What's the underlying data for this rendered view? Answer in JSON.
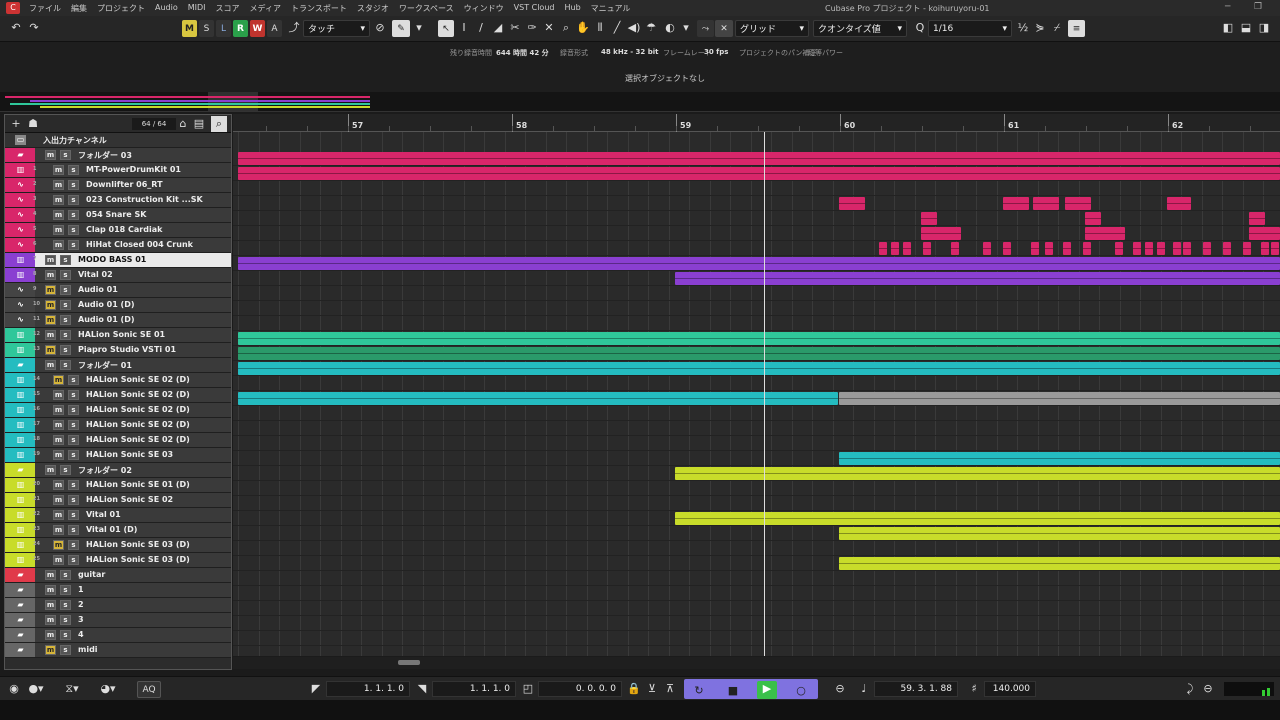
{
  "menu": {
    "items": [
      "ファイル",
      "編集",
      "プロジェクト",
      "Audio",
      "MIDI",
      "スコア",
      "メディア",
      "トランスポート",
      "スタジオ",
      "ワークスペース",
      "ウィンドウ",
      "VST Cloud",
      "Hub",
      "マニュアル"
    ],
    "window_title": "Cubase Pro プロジェクト - koihuruyoru-01"
  },
  "toolbar": {
    "m": "M",
    "s": "S",
    "l": "L",
    "r": "R",
    "w": "W",
    "a": "A",
    "automation_mode": "タッチ",
    "snap_type": "グリッド",
    "quantize_type": "クオンタイズ値",
    "quantize_value": "1/16"
  },
  "info": {
    "rec_time_label": "残り録音時間",
    "rec_time": "644 時間 42 分",
    "rec_format_label": "録音形式",
    "rec_format": "48 kHz - 32 bit",
    "framerate_label": "フレームレート",
    "framerate": "30 fps",
    "pan_label": "プロジェクトのパン補正",
    "pan": "均等パワー"
  },
  "selection": "選択オブジェクトなし",
  "trackpanel": {
    "count": "64 / 64",
    "io_label": "入出力チャンネル"
  },
  "ruler": [
    "57",
    "58",
    "59",
    "60",
    "61",
    "62"
  ],
  "tracks": [
    {
      "name": "フォルダー 03",
      "num": "",
      "type": "folder",
      "color": "#d8266a"
    },
    {
      "name": "MT-PowerDrumKit 01",
      "num": "1",
      "type": "inst",
      "color": "#d8266a"
    },
    {
      "name": "Downlifter 06_RT",
      "num": "2",
      "type": "audio",
      "color": "#d8266a"
    },
    {
      "name": "023 Construction Kit ...SK",
      "num": "3",
      "type": "audio",
      "color": "#d8266a"
    },
    {
      "name": "054 Snare SK",
      "num": "4",
      "type": "audio",
      "color": "#d8266a"
    },
    {
      "name": "Clap 018 Cardiak",
      "num": "5",
      "type": "audio",
      "color": "#d8266a"
    },
    {
      "name": "HiHat Closed 004 Crunk",
      "num": "6",
      "type": "audio",
      "color": "#d8266a"
    },
    {
      "name": "MODO BASS 01",
      "num": "7",
      "type": "inst",
      "color": "#8a3fd1",
      "selected": true
    },
    {
      "name": "Vital 02",
      "num": "8",
      "type": "inst",
      "color": "#8a3fd1"
    },
    {
      "name": "Audio 01",
      "num": "9",
      "type": "audio",
      "color": "#444",
      "mute": true
    },
    {
      "name": "Audio 01 (D)",
      "num": "10",
      "type": "audio",
      "color": "#444",
      "mute": true
    },
    {
      "name": "Audio 01 (D)",
      "num": "11",
      "type": "audio",
      "color": "#444",
      "mute": true
    },
    {
      "name": "HALion Sonic SE 01",
      "num": "12",
      "type": "inst",
      "color": "#2fc79a"
    },
    {
      "name": "Piapro Studio VSTi 01",
      "num": "13",
      "type": "inst",
      "color": "#2fc79a",
      "mute": true
    },
    {
      "name": "フォルダー 01",
      "num": "",
      "type": "folder",
      "color": "#24bcc0"
    },
    {
      "name": "HALion Sonic SE 02 (D)",
      "num": "14",
      "type": "inst",
      "color": "#24bcc0",
      "mute": true
    },
    {
      "name": "HALion Sonic SE 02 (D)",
      "num": "15",
      "type": "inst",
      "color": "#24bcc0"
    },
    {
      "name": "HALion Sonic SE 02 (D)",
      "num": "16",
      "type": "inst",
      "color": "#24bcc0"
    },
    {
      "name": "HALion Sonic SE 02 (D)",
      "num": "17",
      "type": "inst",
      "color": "#24bcc0"
    },
    {
      "name": "HALion Sonic SE 02 (D)",
      "num": "18",
      "type": "inst",
      "color": "#24bcc0"
    },
    {
      "name": "HALion Sonic SE 03",
      "num": "19",
      "type": "inst",
      "color": "#24bcc0"
    },
    {
      "name": "フォルダー 02",
      "num": "",
      "type": "folder",
      "color": "#c8dc2a"
    },
    {
      "name": "HALion Sonic SE 01 (D)",
      "num": "20",
      "type": "inst",
      "color": "#c8dc2a"
    },
    {
      "name": "HALion Sonic SE 02",
      "num": "21",
      "type": "inst",
      "color": "#c8dc2a"
    },
    {
      "name": "Vital 01",
      "num": "22",
      "type": "inst",
      "color": "#c8dc2a"
    },
    {
      "name": "Vital 01 (D)",
      "num": "23",
      "type": "inst",
      "color": "#c8dc2a"
    },
    {
      "name": "HALion Sonic SE 03 (D)",
      "num": "24",
      "type": "inst",
      "color": "#c8dc2a",
      "mute": true
    },
    {
      "name": "HALion Sonic SE 03 (D)",
      "num": "25",
      "type": "inst",
      "color": "#c8dc2a"
    },
    {
      "name": "guitar",
      "num": "",
      "type": "folder",
      "color": "#e03a4a"
    },
    {
      "name": "1",
      "num": "",
      "type": "folder",
      "color": "#666"
    },
    {
      "name": "2",
      "num": "",
      "type": "folder",
      "color": "#666"
    },
    {
      "name": "3",
      "num": "",
      "type": "folder",
      "color": "#666"
    },
    {
      "name": "4",
      "num": "",
      "type": "folder",
      "color": "#666"
    },
    {
      "name": "midi",
      "num": "",
      "type": "folder",
      "color": "#666",
      "mute": true
    }
  ],
  "transport": {
    "left_locator": "1. 1. 1.  0",
    "right_locator": "1. 1. 1.  0",
    "punch": "0. 0. 0.  0",
    "position": "59. 3. 1. 88",
    "tempo": "140.000",
    "aq": "AQ"
  }
}
